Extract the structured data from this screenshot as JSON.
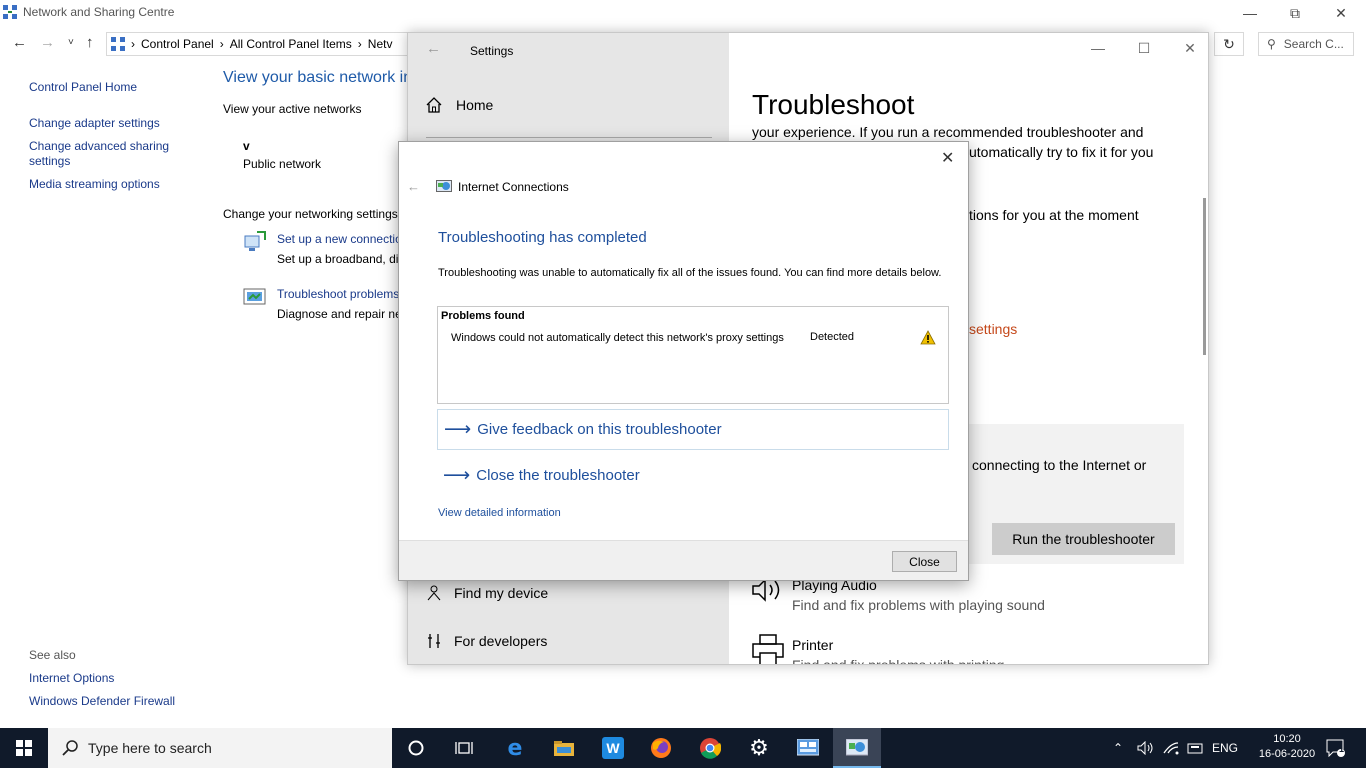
{
  "control_panel": {
    "title": "Network and Sharing Centre",
    "address": {
      "crumb1": "Control Panel",
      "crumb2": "All Control Panel Items",
      "crumb3": "Netv"
    },
    "search_placeholder": "Search C...",
    "sidebar": {
      "home": "Control Panel Home",
      "adapter": "Change adapter settings",
      "advanced": "Change advanced sharing settings",
      "media": "Media streaming options",
      "see_also": "See also",
      "internet_options": "Internet Options",
      "firewall": "Windows Defender Firewall"
    },
    "heading": "View your basic network in",
    "active_networks": "View your active networks",
    "network_name": "v",
    "network_type": "Public network",
    "change_settings": "Change your networking settings",
    "setup_link": "Set up a new connectio",
    "setup_desc": "Set up a broadband, di",
    "troubleshoot_link": "Troubleshoot problems",
    "troubleshoot_desc": "Diagnose and repair ne"
  },
  "settings": {
    "title": "Settings",
    "home": "Home",
    "nav_find_device": "Find my device",
    "nav_developers": "For developers",
    "heading": "Troubleshoot",
    "text1": "your experience. If you run a recommended troubleshooter and",
    "text2": "utomatically try to fix it for you",
    "text3": "tions for you at the moment",
    "orange_link": "settings",
    "card_text": "connecting to the Internet or",
    "run_button": "Run the troubleshooter",
    "audio_title": "Playing Audio",
    "audio_desc": "Find and fix problems with playing sound",
    "printer_title": "Printer",
    "printer_desc": "Find and fix problems with printing"
  },
  "dialog": {
    "app_name": "Internet Connections",
    "heading": "Troubleshooting has completed",
    "description": "Troubleshooting was unable to automatically fix all of the issues found. You can find more details below.",
    "problems_header": "Problems found",
    "problem_text": "Windows could not automatically detect this network's proxy settings",
    "problem_status": "Detected",
    "feedback_link": "Give feedback on this troubleshooter",
    "close_link": "Close the troubleshooter",
    "detail_link": "View detailed information",
    "close_button": "Close"
  },
  "taskbar": {
    "search_placeholder": "Type here to search",
    "language": "ENG",
    "time": "10:20",
    "date": "16-06-2020",
    "notifications": "1"
  },
  "colors": {
    "accent": "#1e4f9c",
    "link": "#1a3a8a",
    "warning": "#f0c000",
    "orange": "#c5481a",
    "taskbar": "#101a2a"
  }
}
